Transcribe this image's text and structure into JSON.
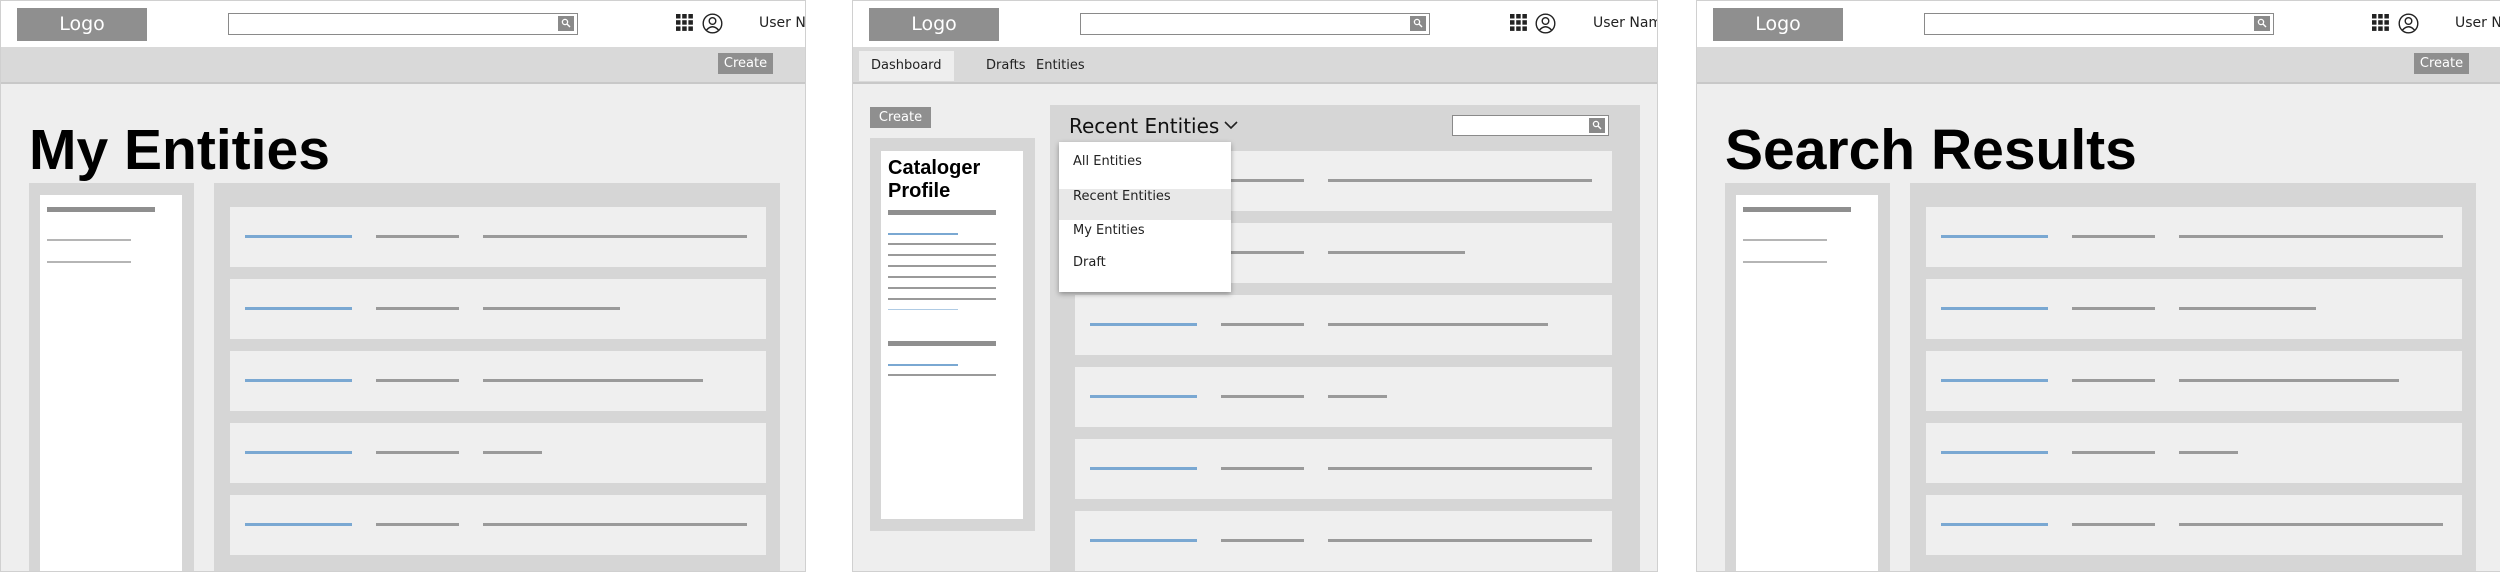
{
  "colors": {
    "accent_blue": "#7aa8d2",
    "placeholder_gray": "#8f8f8f",
    "panel": "#d6d6d6"
  },
  "header": {
    "logo": "Logo",
    "user_name_frame1": "User Nc",
    "user_name_frame2": "User Name",
    "user_name_frame3": "User Nc",
    "search_icon": "search-icon",
    "apps_icon": "apps-grid-icon",
    "user_icon": "user-avatar-icon"
  },
  "actions": {
    "create": "Create"
  },
  "my_entities": {
    "title": "My Entities",
    "row_count": 5
  },
  "dashboard": {
    "tabs": [
      {
        "label": "Dashboard",
        "active": true
      },
      {
        "label": "Drafts",
        "active": false
      },
      {
        "label": "Entities",
        "active": false
      }
    ],
    "profile_title_line1": "Cataloger",
    "profile_title_line2": "Profile",
    "recent_title": "Recent Entities",
    "dropdown_options": [
      {
        "label": "All Entities",
        "highlighted": false
      },
      {
        "label": "Recent Entities",
        "highlighted": true
      },
      {
        "label": "My Entities",
        "highlighted": false
      },
      {
        "label": "Draft",
        "highlighted": false
      }
    ]
  },
  "search_results": {
    "title": "Search Results",
    "row_count": 5
  }
}
